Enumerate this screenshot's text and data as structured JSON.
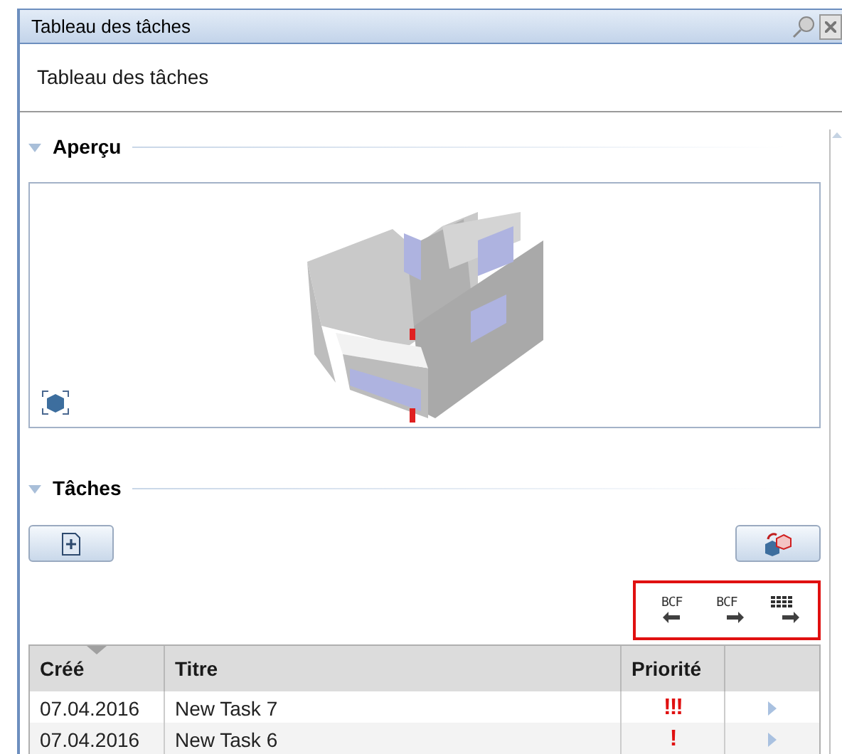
{
  "window": {
    "title": "Tableau des tâches"
  },
  "header": {
    "title": "Tableau des tâches"
  },
  "preview": {
    "heading": "Aperçu",
    "expanded": true
  },
  "tasks": {
    "heading": "Tâches",
    "expanded": true,
    "export_tools": [
      {
        "kind": "bcf-import",
        "label": "BCF"
      },
      {
        "kind": "bcf-export",
        "label": "BCF"
      },
      {
        "kind": "table-export"
      }
    ],
    "table": {
      "columns": [
        "Créé",
        "Titre",
        "Priorité"
      ],
      "rows": [
        {
          "created": "07.04.2016",
          "title": "New Task 7",
          "priority": "!!!",
          "selected": false
        },
        {
          "created": "07.04.2016",
          "title": "New Task 6",
          "priority": "!",
          "selected": false
        }
      ]
    }
  }
}
